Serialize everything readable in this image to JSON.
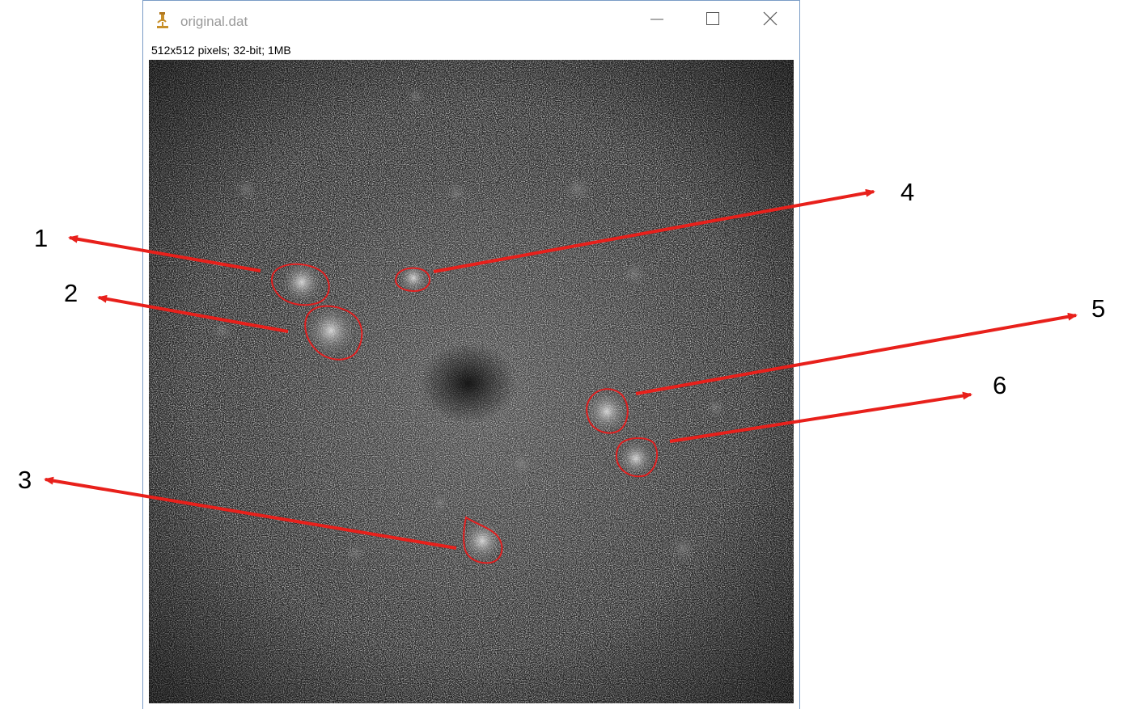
{
  "window": {
    "title": "original.dat",
    "app_icon": "microscope-icon",
    "status_text": "512x512 pixels; 32-bit; 1MB",
    "controls": {
      "minimize_icon": "minimize-icon",
      "maximize_icon": "maximize-icon",
      "close_icon": "close-icon"
    }
  },
  "annotations": {
    "labels": [
      "1",
      "2",
      "3",
      "4",
      "5",
      "6"
    ],
    "arrow_color": "#e8201b",
    "roi_color": "#e02020"
  },
  "colors": {
    "image_background": "#2a2a2a",
    "window_border": "#7a9cc6",
    "title_text": "#9a9a9a"
  }
}
